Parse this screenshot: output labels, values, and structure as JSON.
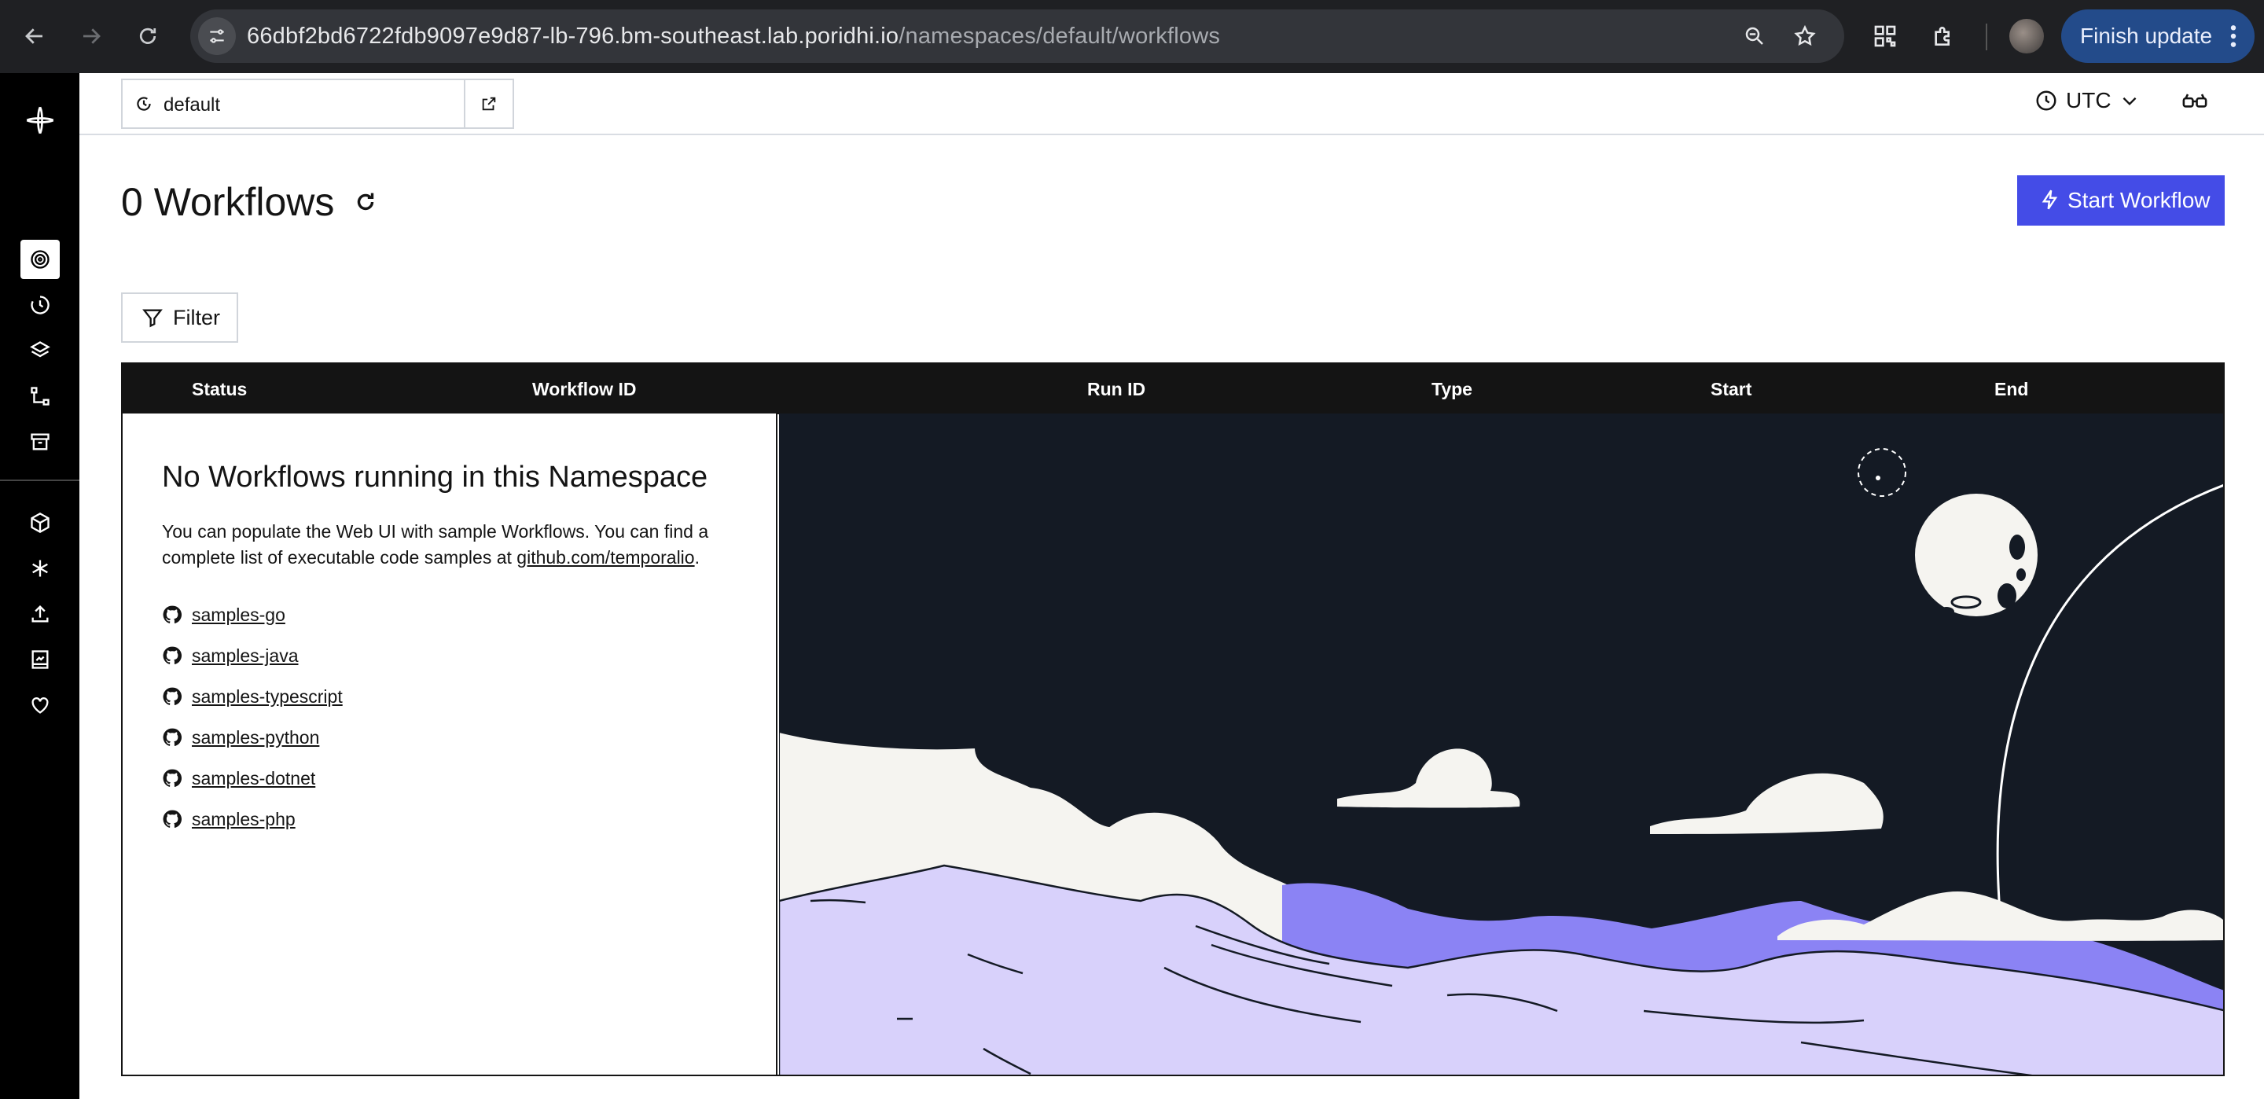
{
  "browser": {
    "url_host": "66dbf2bd6722fdb9097e9d87-lb-796.bm-southeast.lab.poridhi.io",
    "url_path": "/namespaces/default/workflows",
    "finish_update_label": "Finish update"
  },
  "header": {
    "namespace": "default",
    "timezone": "UTC"
  },
  "page": {
    "title": "0 Workflows",
    "start_workflow_label": "Start Workflow",
    "filter_label": "Filter"
  },
  "table": {
    "columns": [
      "Status",
      "Workflow ID",
      "Run ID",
      "Type",
      "Start",
      "End"
    ]
  },
  "empty_state": {
    "heading": "No Workflows running in this Namespace",
    "text_before_link": "You can populate the Web UI with sample Workflows. You can find a complete list of executable code samples at ",
    "link_text": "github.com/temporalio",
    "text_after_link": ".",
    "samples": [
      "samples-go",
      "samples-java",
      "samples-typescript",
      "samples-python",
      "samples-dotnet",
      "samples-php"
    ]
  },
  "colors": {
    "accent": "#444ce7",
    "sidebar": "#000000",
    "table_header": "#141414",
    "night_sky": "#141a24",
    "mountain_lavender": "#d8d1fb",
    "mountain_purple": "#8b83f4"
  }
}
